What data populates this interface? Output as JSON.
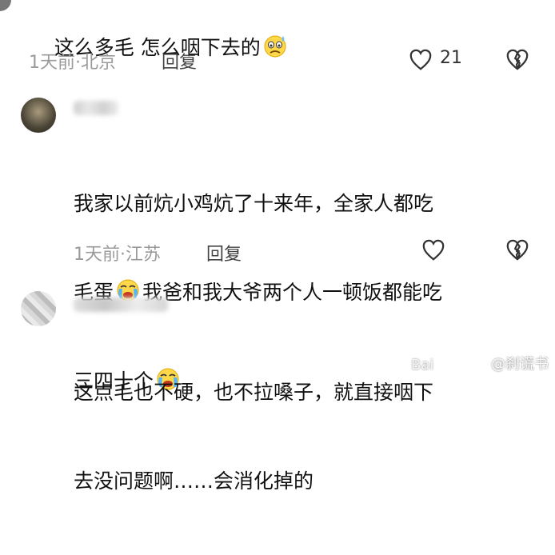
{
  "comments": [
    {
      "text_parts": [
        "这么多毛 怎么咽下去的"
      ],
      "emoji": [
        "sweat-face-emoji"
      ],
      "time_location": "1天前·北京",
      "reply_label": "回复",
      "like_count": "21"
    },
    {
      "text_line1": "我家以前炕小鸡炕了十来年，全家人都吃",
      "text_line2a": "毛蛋",
      "text_line2b": "我爸和我大爷两个人一顿饭都能吃",
      "text_line3": "三四十个",
      "emoji": [
        "crying-face-emoji",
        "crying-face-emoji"
      ],
      "time_location": "1天前·江苏",
      "reply_label": "回复"
    },
    {
      "text_line1": "这点毛也不硬，也不拉嗓子，就直接咽下",
      "text_line2": "去没问题啊……会消化掉的",
      "time_location": "",
      "reply_label": ""
    }
  ],
  "watermark": {
    "left": "Bai",
    "right": "@刹谎书"
  },
  "colors": {
    "text": "#111111",
    "meta": "#9a9a9a",
    "icon": "#333333"
  }
}
